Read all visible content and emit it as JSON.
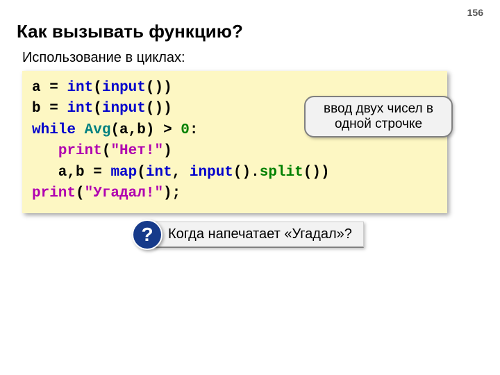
{
  "page_number": "156",
  "title": "Как вызывать функцию?",
  "subtitle": "Использование в циклах:",
  "code": {
    "l1_a": "a ",
    "l1_eq": "=",
    "l1_sp": " ",
    "l1_int": "int",
    "l1_p1": "(",
    "l1_input": "input",
    "l1_p2": "())",
    "l2_b": "b ",
    "l2_eq": "=",
    "l2_sp": " ",
    "l2_int": "int",
    "l2_p1": "(",
    "l2_input": "input",
    "l2_p2": "())",
    "l3_while": "while",
    "l3_sp1": " ",
    "l3_avg": "Avg",
    "l3_args": "(a,b) ",
    "l3_gt": ">",
    "l3_sp2": " ",
    "l3_zero": "0",
    "l3_colon": ":",
    "l4_indent": "   ",
    "l4_print": "print",
    "l4_p1": "(",
    "l4_str": "\"Нет!\"",
    "l4_p2": ")",
    "l5_indent": "   a,b ",
    "l5_eq": "=",
    "l5_sp": " ",
    "l5_map": "map",
    "l5_p1": "(",
    "l5_int": "int",
    "l5_comma": ", ",
    "l5_input": "input",
    "l5_p2": "().",
    "l5_split": "split",
    "l5_p3": "())",
    "l6_print": "print",
    "l6_p1": "(",
    "l6_str": "\"Угадал!\"",
    "l6_p2": ");"
  },
  "callout": "ввод двух чисел в одной строчке",
  "question_mark": "?",
  "question_text": " Когда напечатает «Угадал»?"
}
